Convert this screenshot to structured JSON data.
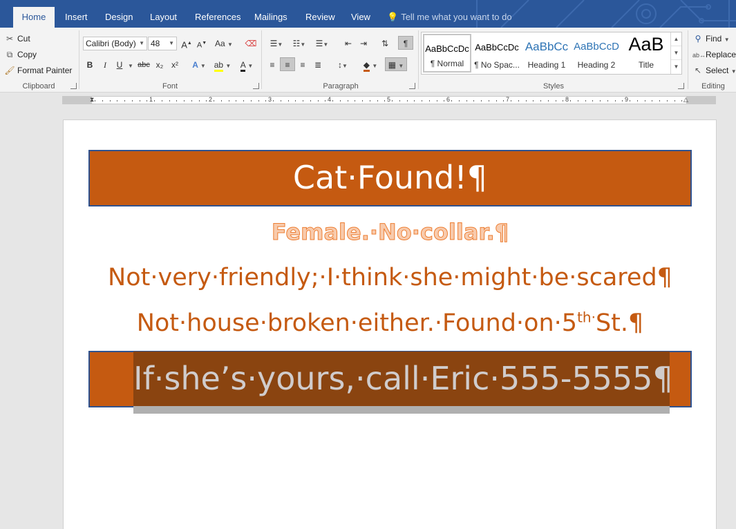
{
  "tabs": [
    "Home",
    "Insert",
    "Design",
    "Layout",
    "References",
    "Mailings",
    "Review",
    "View"
  ],
  "tellme": "Tell me what you want to do",
  "clipboard": {
    "cut": "Cut",
    "copy": "Copy",
    "format_painter": "Format Painter",
    "label": "Clipboard"
  },
  "font": {
    "name": "Calibri (Body)",
    "size": "48",
    "label": "Font",
    "bold": "B",
    "italic": "I",
    "underline": "U",
    "strike": "abc",
    "subscript": "x₂",
    "superscript": "x²",
    "grow": "A",
    "shrink": "A",
    "case": "Aa",
    "font_color": "A"
  },
  "paragraph": {
    "label": "Paragraph",
    "pilcrow": "¶"
  },
  "styles": {
    "label": "Styles",
    "items": [
      {
        "preview": "AaBbCcDc",
        "name": "¶ Normal"
      },
      {
        "preview": "AaBbCcDc",
        "name": "¶ No Spac..."
      },
      {
        "preview": "AaBbCc",
        "name": "Heading 1"
      },
      {
        "preview": "AaBbCcD",
        "name": "Heading 2"
      },
      {
        "preview": "AaB",
        "name": "Title"
      }
    ]
  },
  "editing": {
    "label": "Editing",
    "find": "Find",
    "replace": "Replace",
    "select": "Select"
  },
  "ruler": {
    "numbers": [
      "1",
      "1",
      "2",
      "3",
      "4",
      "5",
      "6",
      "7",
      "8",
      "9"
    ]
  },
  "document": {
    "title": "Cat·Found!¶",
    "line1": "Female.·No·collar.¶",
    "line2": "Not·very·friendly;·I·think·she·might·be·scared¶",
    "line3_pre": "Not·house·broken·either.·Found·on·5",
    "line3_sup": "th·",
    "line3_post": "St.¶",
    "line4": "If·she’s·yours,·call·Eric·555-5555¶"
  },
  "colors": {
    "accent": "#2b579a",
    "banner": "#c55a11",
    "banner_border": "#2f528f",
    "text_orange": "#c55a11",
    "outline_fill": "#f8cbad"
  }
}
